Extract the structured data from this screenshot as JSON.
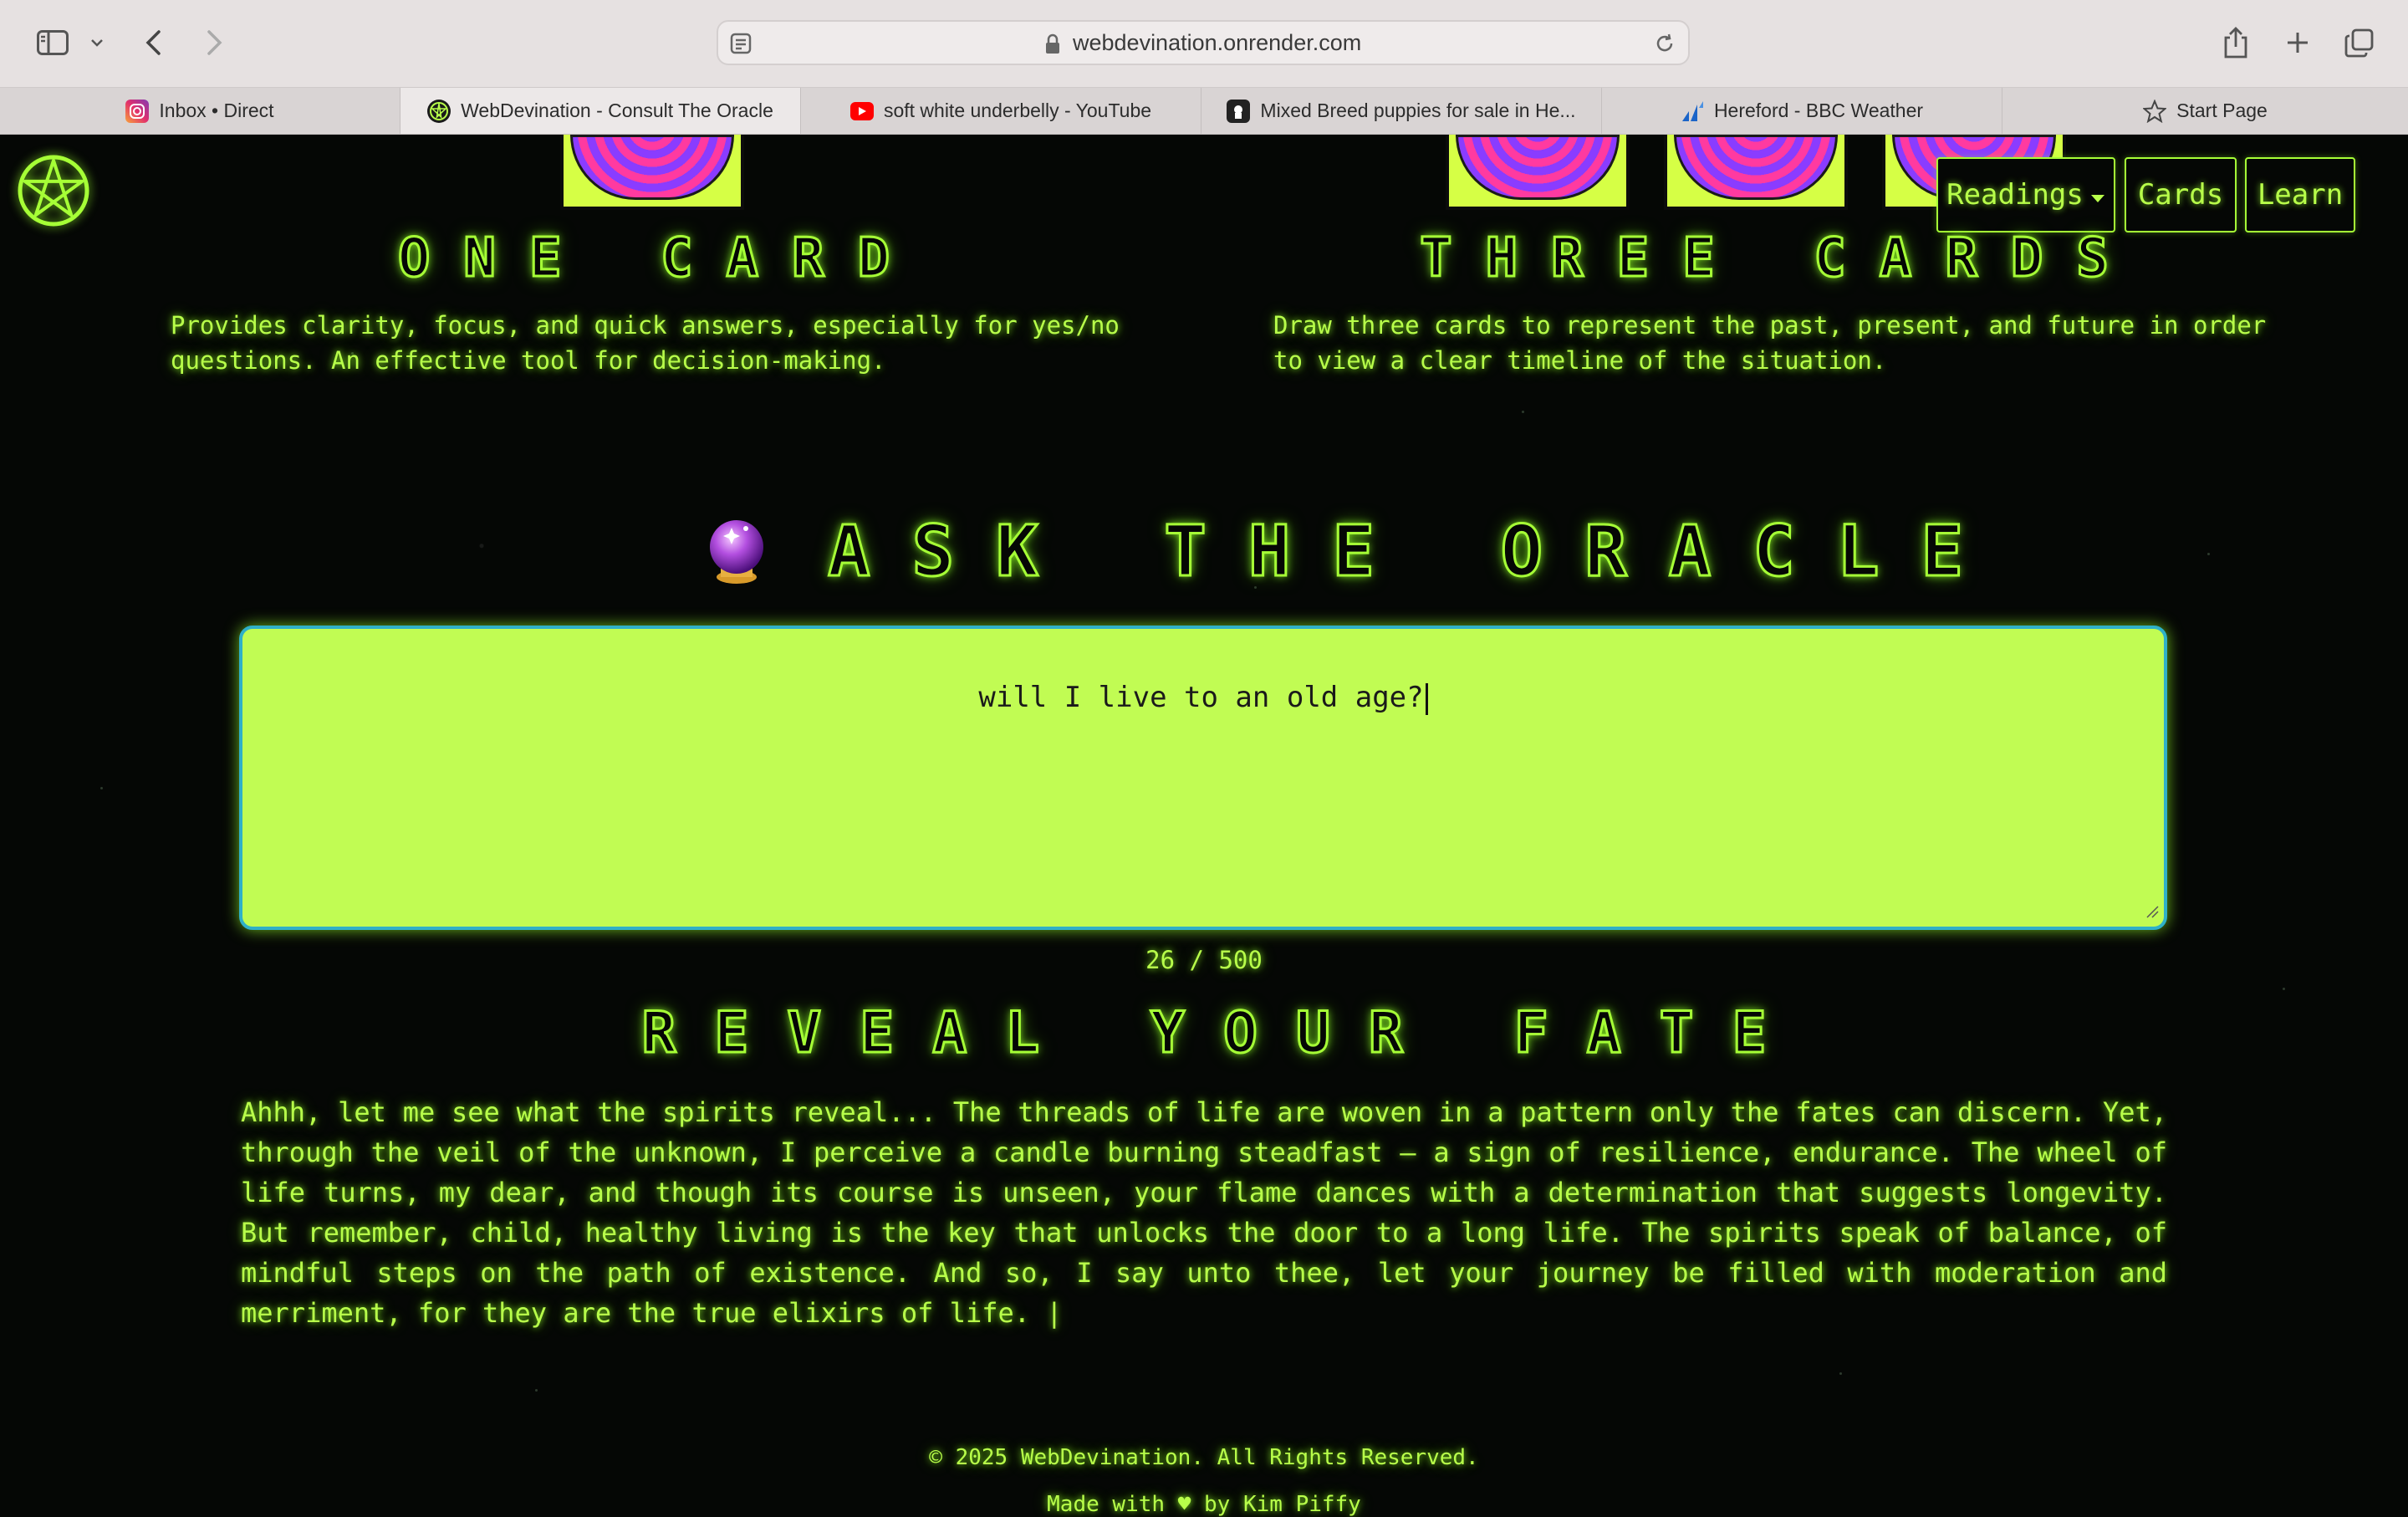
{
  "browser": {
    "url": "webdevination.onrender.com",
    "tabs": [
      {
        "label": "Inbox • Direct",
        "icon": "instagram-icon",
        "active": false
      },
      {
        "label": "WebDevination - Consult The Oracle",
        "icon": "pentagram-icon",
        "active": true
      },
      {
        "label": "soft white underbelly - YouTube",
        "icon": "youtube-icon",
        "active": false
      },
      {
        "label": "Mixed Breed puppies for sale in He...",
        "icon": "puppy-site-icon",
        "active": false
      },
      {
        "label": "Hereford - BBC Weather",
        "icon": "bbc-weather-icon",
        "active": false
      },
      {
        "label": "Start Page",
        "icon": "star-icon",
        "active": false
      }
    ]
  },
  "nav": {
    "readings": "Readings",
    "cards": "Cards",
    "learn": "Learn"
  },
  "readings": {
    "one_card": {
      "title": "ONE CARD",
      "description_line1": "Provides clarity, focus, and quick answers, especially for yes/no",
      "description_line2": "questions. An effective tool for decision-making."
    },
    "three_cards": {
      "title": "THREE CARDS",
      "description_line1": "Draw three cards to represent the past, present, and future in order",
      "description_line2": "to view a clear timeline of the situation."
    }
  },
  "oracle": {
    "heading": "ASK THE ORACLE",
    "question": "will I live to an old age?",
    "counter": "26 / 500"
  },
  "fate": {
    "heading": "REVEAL YOUR FATE",
    "answer": "Ahhh, let me see what the spirits reveal... The threads of life are woven in a pattern only the fates can discern. Yet, through the veil of the unknown, I perceive a candle burning steadfast – a sign of resilience, endurance. The wheel of life turns, my dear, and though its course is unseen, your flame dances with a determination that suggests longevity. But remember, child, healthy living is the key that unlocks the door to a long life. The spirits speak of balance, of mindful steps on the path of existence. And so, I say unto thee, let your journey be filled with moderation and merriment, for they are the true elixirs of life. |"
  },
  "footer": {
    "copyright": "© 2025 WebDevination. All Rights Reserved.",
    "made_with": "Made with ♥ by Kim Piffy"
  },
  "colors": {
    "accent": "#b8ff4a",
    "input_bg": "#c1fc53",
    "background": "#050705"
  }
}
